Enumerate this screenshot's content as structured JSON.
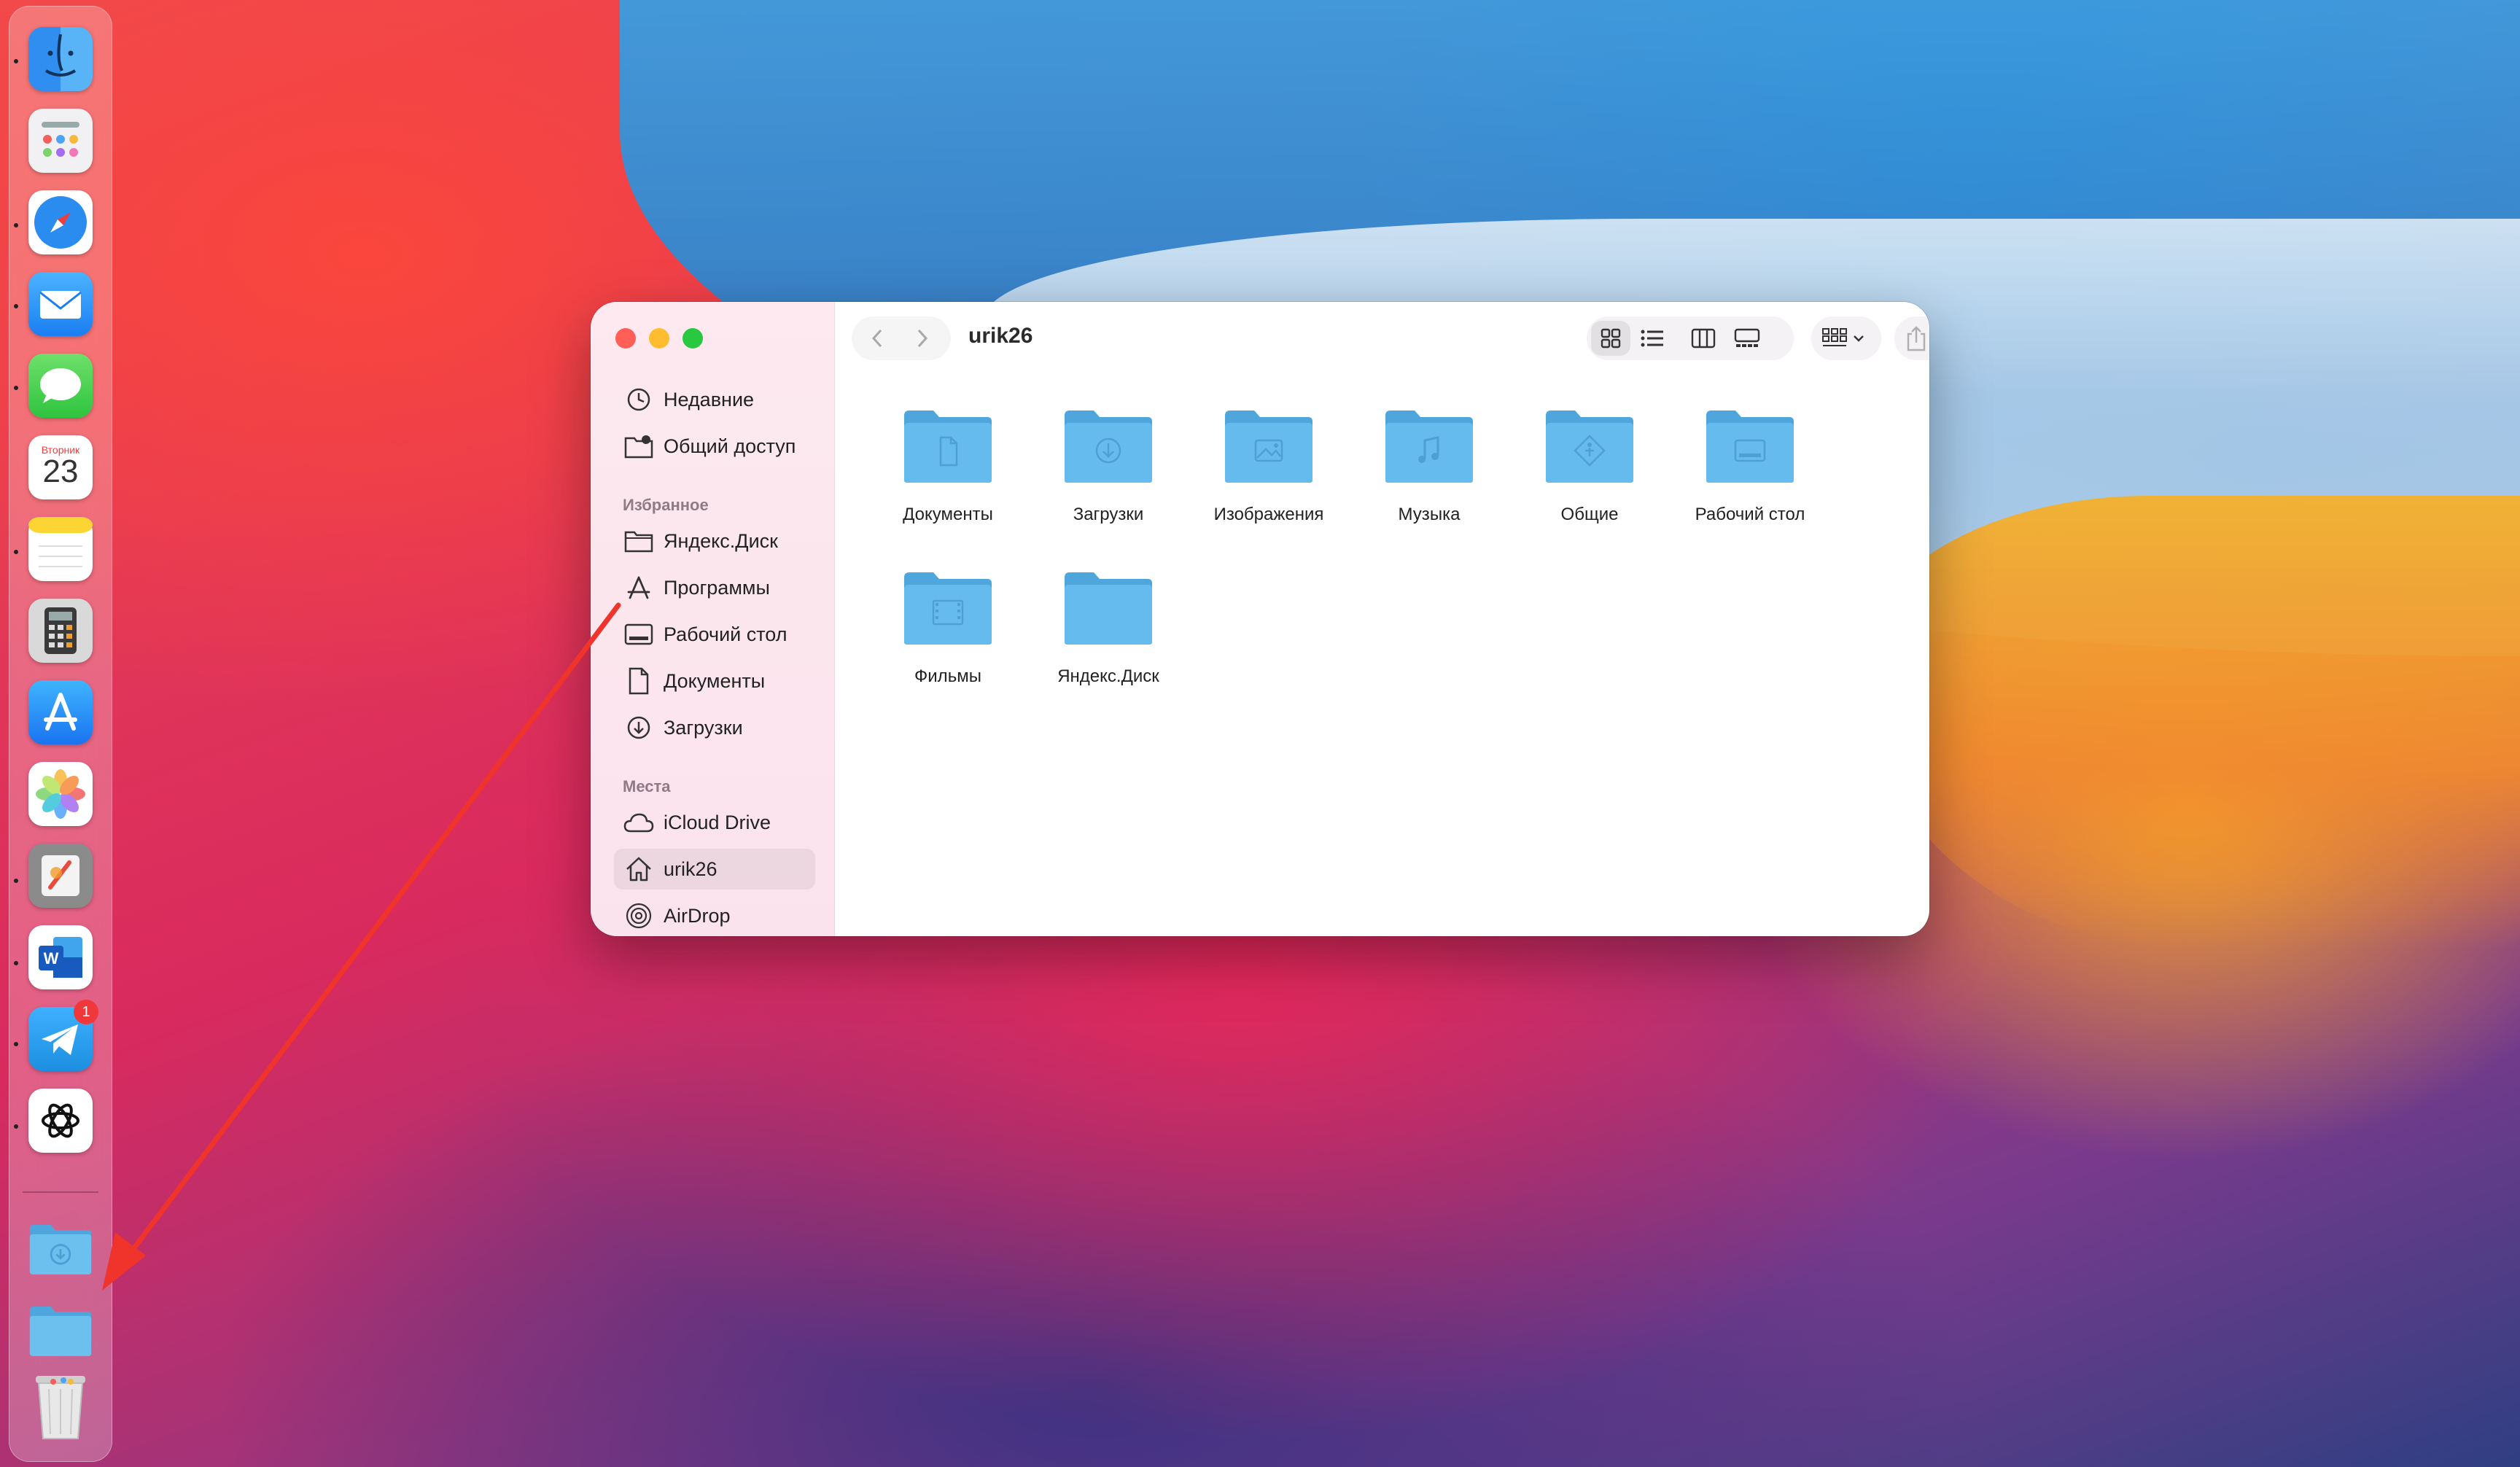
{
  "dock": {
    "apps": [
      {
        "name": "Finder",
        "icon": "finder-icon",
        "running": true
      },
      {
        "name": "Launchpad",
        "icon": "launchpad-icon",
        "running": false
      },
      {
        "name": "Safari",
        "icon": "safari-icon",
        "running": true
      },
      {
        "name": "Mail",
        "icon": "mail-icon",
        "running": true
      },
      {
        "name": "Messages",
        "icon": "messages-icon",
        "running": true
      },
      {
        "name": "Calendar",
        "icon": "calendar-icon",
        "running": false,
        "weekday": "Вторник",
        "day": "23"
      },
      {
        "name": "Notes",
        "icon": "notes-icon",
        "running": true
      },
      {
        "name": "Calculator",
        "icon": "calculator-icon",
        "running": false
      },
      {
        "name": "App Store",
        "icon": "app-store-icon",
        "running": false
      },
      {
        "name": "Photos",
        "icon": "photos-icon",
        "running": false
      },
      {
        "name": "Pixelmator",
        "icon": "pixelmator-icon",
        "running": true
      },
      {
        "name": "Word",
        "icon": "word-icon",
        "running": true
      },
      {
        "name": "Telegram",
        "icon": "telegram-icon",
        "running": true,
        "badge": "1"
      },
      {
        "name": "ChatGPT",
        "icon": "chatgpt-icon",
        "running": true
      }
    ],
    "stacks": [
      {
        "name": "Downloads",
        "icon": "downloads-folder-icon"
      },
      {
        "name": "Folder",
        "icon": "folder-icon"
      },
      {
        "name": "Trash",
        "icon": "trash-icon"
      }
    ]
  },
  "finder": {
    "title": "urik26",
    "sidebar": {
      "top_items": [
        {
          "label": "Недавние",
          "icon": "clock-icon"
        },
        {
          "label": "Общий доступ",
          "icon": "shared-folder-icon"
        }
      ],
      "favorites_header": "Избранное",
      "favorites": [
        {
          "label": "Яндекс.Диск",
          "icon": "folder-outline-icon"
        },
        {
          "label": "Программы",
          "icon": "applications-icon"
        },
        {
          "label": "Рабочий стол",
          "icon": "desktop-icon"
        },
        {
          "label": "Документы",
          "icon": "document-icon"
        },
        {
          "label": "Загрузки",
          "icon": "download-icon"
        }
      ],
      "places_header": "Места",
      "places": [
        {
          "label": "iCloud Drive",
          "icon": "cloud-icon"
        },
        {
          "label": "urik26",
          "icon": "home-icon",
          "active": true
        },
        {
          "label": "AirDrop",
          "icon": "airdrop-icon"
        }
      ]
    },
    "folders": [
      {
        "label": "Документы",
        "glyph": "document"
      },
      {
        "label": "Загрузки",
        "glyph": "download"
      },
      {
        "label": "Изображения",
        "glyph": "picture"
      },
      {
        "label": "Музыка",
        "glyph": "music"
      },
      {
        "label": "Общие",
        "glyph": "public"
      },
      {
        "label": "Рабочий стол",
        "glyph": "desktop"
      },
      {
        "label": "Фильмы",
        "glyph": "film"
      },
      {
        "label": "Яндекс.Диск",
        "glyph": "none"
      }
    ]
  },
  "colors": {
    "folder_blue": "#5ab4e8",
    "folder_tab": "#4fa6dc",
    "arrow_red": "#f0332b",
    "close": "#ff5f57",
    "minimize": "#febc2e",
    "maximize": "#28c840"
  }
}
